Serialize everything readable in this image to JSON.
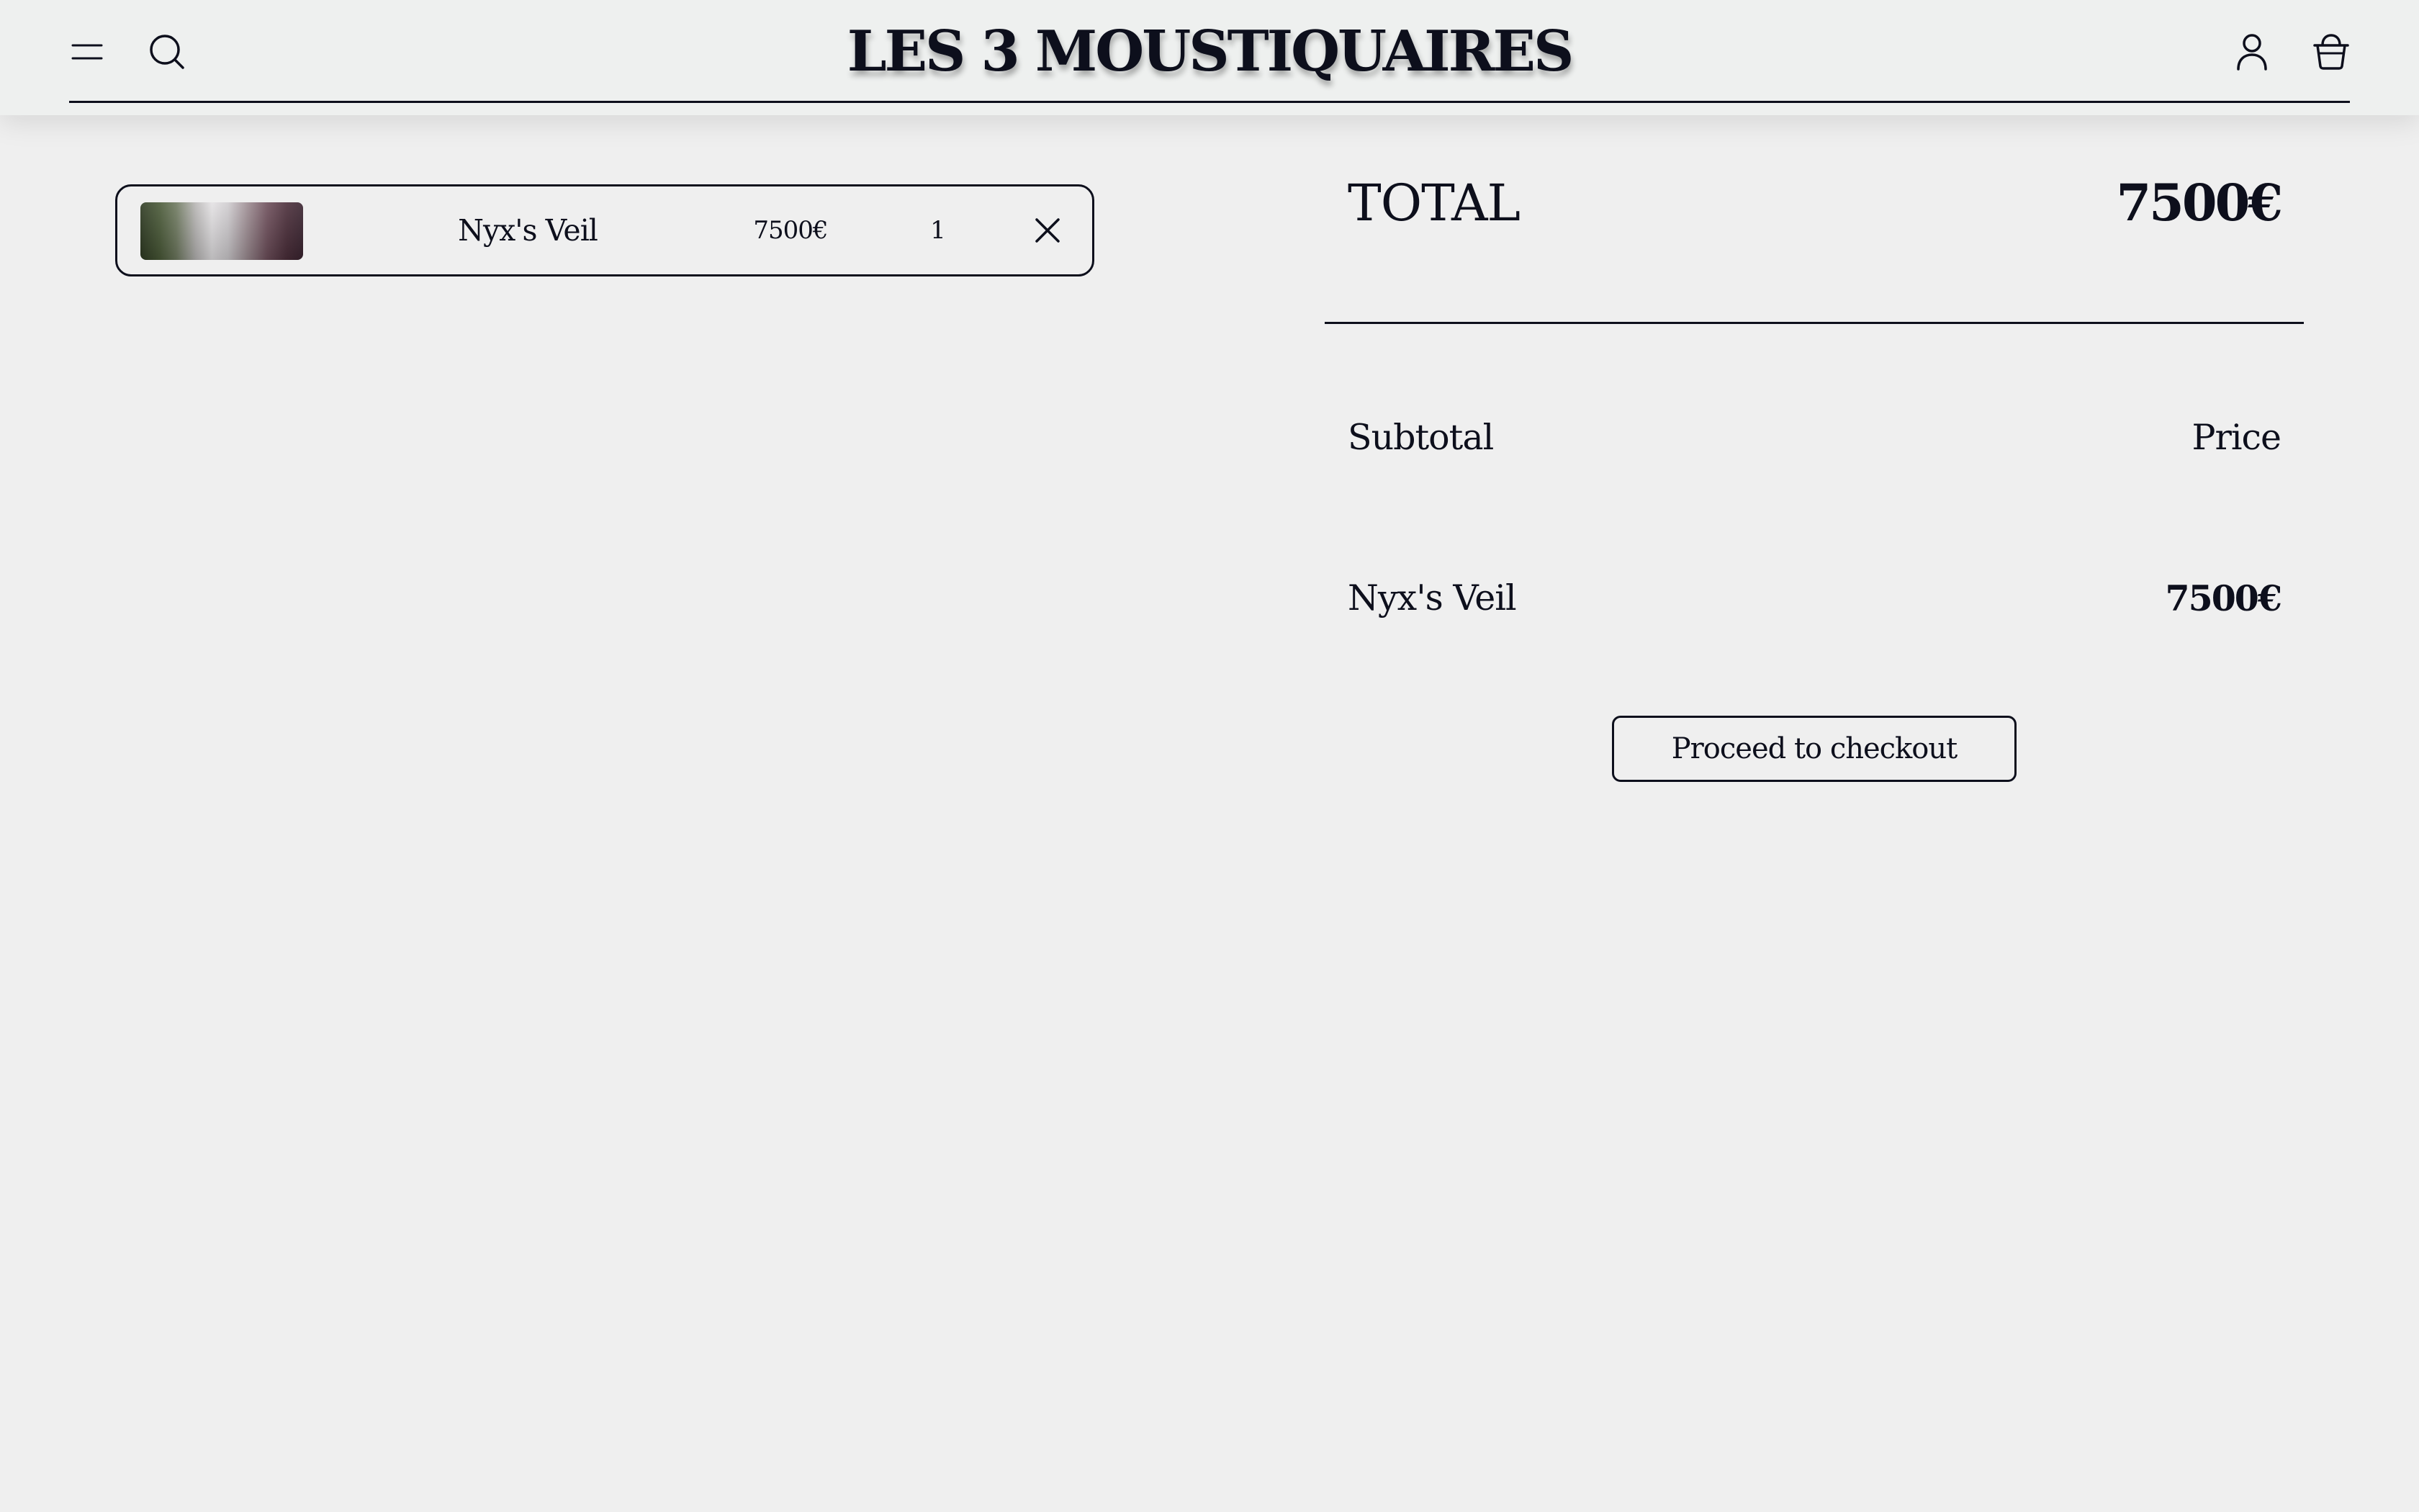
{
  "header": {
    "brand": "LES 3 MOUSTIQUAIRES",
    "icons": {
      "menu": "menu-icon",
      "search": "search-icon",
      "account": "account-icon",
      "cart": "shopping-basket-icon"
    }
  },
  "cart": {
    "items": [
      {
        "name": "Nyx's Veil",
        "price": "7500€",
        "quantity": "1",
        "remove_icon": "close-icon"
      }
    ]
  },
  "summary": {
    "total_label": "TOTAL",
    "total_value": "7500€",
    "subtotal_label": "Subtotal",
    "price_header": "Price",
    "lines": [
      {
        "name": "Nyx's Veil",
        "price": "7500€"
      }
    ],
    "checkout_label": "Proceed to checkout"
  },
  "colors": {
    "background": "#efefef",
    "header_background": "#eef0ef",
    "ink": "#0d0f1c"
  }
}
